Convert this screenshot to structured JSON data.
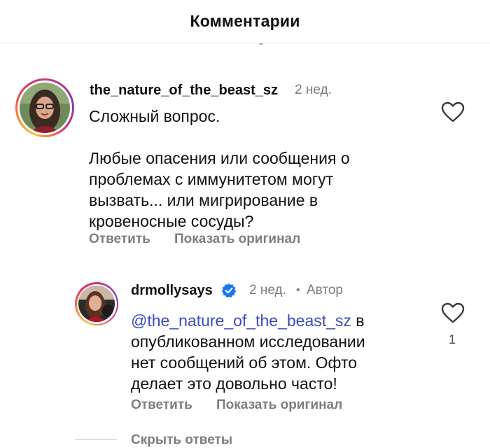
{
  "header": {
    "title": "Комментарии"
  },
  "comments": [
    {
      "username": "the_nature_of_the_beast_sz",
      "time": "2 нед.",
      "lines": [
        "Сложный вопрос.",
        "",
        "Любые опасения или сообщения о",
        "проблемах с иммунитетом могут",
        "вызвать... или мигрирование в",
        "кровеносные сосуды?"
      ],
      "reply_label": "Ответить",
      "translate_label": "Показать оригинал"
    }
  ],
  "reply": {
    "username": "drmollysays",
    "time": "2 нед.",
    "dot": "•",
    "role": "Автор",
    "mention": "@the_nature_of_the_beast_sz",
    "first_line_rest": " в",
    "lines": [
      "опубликованном исследовании",
      "нет сообщений об этом. Офто",
      "делает это довольно часто!"
    ],
    "likes": "1",
    "reply_label": "Ответить",
    "translate_label": "Показать оригинал"
  },
  "hide_replies_label": "Скрыть ответы",
  "colors": {
    "mention": "#3b4cc0",
    "verified": "#1877f2",
    "muted": "#7d7d7d"
  },
  "icons": [
    "heart-icon",
    "verified-badge-icon"
  ]
}
